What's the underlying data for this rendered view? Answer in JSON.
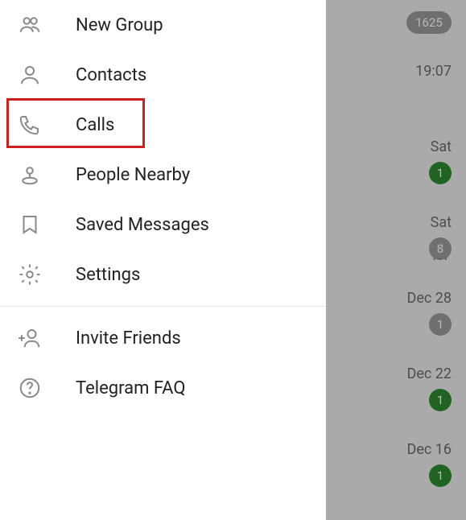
{
  "menu": {
    "new_group": "New Group",
    "contacts": "Contacts",
    "calls": "Calls",
    "people_nearby": "People Nearby",
    "saved_messages": "Saved Messages",
    "settings": "Settings",
    "invite_friends": "Invite Friends",
    "telegram_faq": "Telegram FAQ"
  },
  "chats": [
    {
      "time": "",
      "badge": "1625",
      "badge_color": "grey",
      "wide": true
    },
    {
      "time": "19:07",
      "badge": "",
      "badge_color": ""
    },
    {
      "time": "Sat",
      "badge": "1",
      "badge_color": "green"
    },
    {
      "time": "Sat",
      "badge": "8",
      "badge_color": "grey"
    },
    {
      "time": "Dec 28",
      "badge": "1",
      "badge_color": "grey"
    },
    {
      "time": "Dec 22",
      "badge": "1",
      "badge_color": "green"
    },
    {
      "time": "Dec 16",
      "badge": "1",
      "badge_color": "green"
    }
  ]
}
